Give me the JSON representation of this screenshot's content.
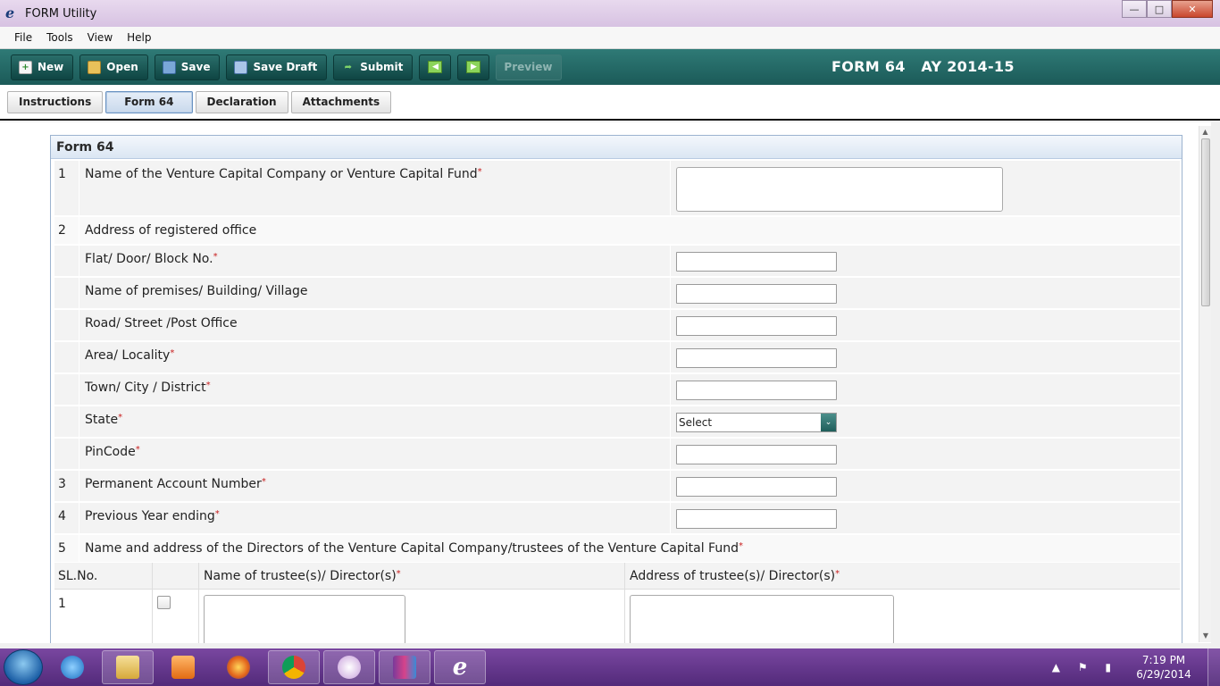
{
  "window": {
    "title": "FORM Utility"
  },
  "menu": [
    "File",
    "Tools",
    "View",
    "Help"
  ],
  "toolbar": {
    "new": "New",
    "open": "Open",
    "save": "Save",
    "save_draft": "Save Draft",
    "submit": "Submit",
    "preview": "Preview",
    "heading": "FORM 64   AY 2014-15"
  },
  "tabs": [
    "Instructions",
    "Form 64",
    "Declaration",
    "Attachments"
  ],
  "panel": {
    "title": "Form 64"
  },
  "rows": [
    {
      "num": "1",
      "label": "Name of the Venture Capital Company or Venture Capital Fund",
      "req": "*"
    },
    {
      "num": "2",
      "label": "Address of registered office",
      "req": ""
    },
    {
      "num": "",
      "label": "Flat/ Door/ Block No.",
      "req": "*"
    },
    {
      "num": "",
      "label": "Name of premises/ Building/ Village",
      "req": ""
    },
    {
      "num": "",
      "label": "Road/ Street /Post Office",
      "req": ""
    },
    {
      "num": "",
      "label": "Area/ Locality",
      "req": "*"
    },
    {
      "num": "",
      "label": "Town/ City / District",
      "req": "*"
    },
    {
      "num": "",
      "label": "State",
      "req": "*"
    },
    {
      "num": "",
      "label": "PinCode",
      "req": "*"
    },
    {
      "num": "3",
      "label": "Permanent Account Number",
      "req": "*"
    },
    {
      "num": "4",
      "label": "Previous Year ending",
      "req": "*"
    },
    {
      "num": "5",
      "label": "Name and address of the Directors of the Venture Capital Company/trustees of the Venture Capital Fund",
      "req": "*"
    }
  ],
  "state_select": {
    "value": "Select"
  },
  "grid": {
    "headers": {
      "slno": "SL.No.",
      "name": "Name of trustee(s)/ Director(s)",
      "address": "Address of trustee(s)/ Director(s)"
    },
    "row1": {
      "slno": "1"
    }
  },
  "taskbar": {
    "time": "7:19 PM",
    "date": "6/29/2014"
  }
}
